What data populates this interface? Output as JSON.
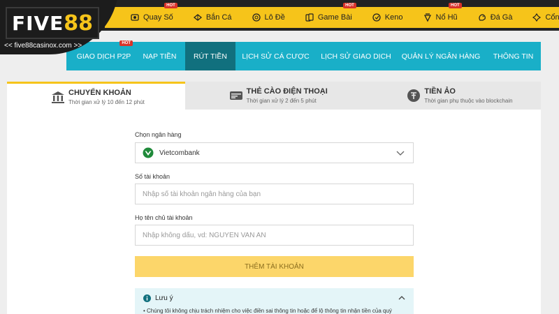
{
  "brand": {
    "logo_text_1": "FIVE",
    "logo_text_2": "88",
    "site_url": "<< five88casinox.com >>"
  },
  "game_nav": [
    {
      "label": "Quay Số",
      "icon": "lottery-icon",
      "hot": "HOT"
    },
    {
      "label": "Bắn Cá",
      "icon": "fish-icon",
      "hot": ""
    },
    {
      "label": "Lô Đề",
      "icon": "ball-icon",
      "hot": ""
    },
    {
      "label": "Game Bài",
      "icon": "cards-icon",
      "hot": "HOT"
    },
    {
      "label": "Keno",
      "icon": "keno-icon",
      "hot": ""
    },
    {
      "label": "Nổ Hũ",
      "icon": "slot-icon",
      "hot": "HOT"
    },
    {
      "label": "Đá Gà",
      "icon": "rooster-icon",
      "hot": ""
    },
    {
      "label": "Cổng Game",
      "icon": "gamepad-icon",
      "hot": ""
    }
  ],
  "account_tabs": [
    {
      "label": "GIAO DỊCH P2P",
      "hot": "HOT"
    },
    {
      "label": "NẠP TIỀN",
      "hot": ""
    },
    {
      "label": "RÚT TIỀN",
      "hot": ""
    },
    {
      "label": "LỊCH SỬ CÁ CƯỢC",
      "hot": ""
    },
    {
      "label": "LỊCH SỬ GIAO DỊCH",
      "hot": ""
    },
    {
      "label": "QUẢN LÝ NGÂN HÀNG",
      "hot": ""
    },
    {
      "label": "THÔNG TIN",
      "hot": ""
    }
  ],
  "methods": [
    {
      "title": "CHUYỂN KHOẢN",
      "sub": "Thời gian xử lý 10 đến 12 phút",
      "icon": "bank-icon"
    },
    {
      "title": "THẺ CÀO ĐIỆN THOẠI",
      "sub": "Thời gian xử lý 2 đến 5 phút",
      "icon": "card-icon"
    },
    {
      "title": "TIỀN ẢO",
      "sub": "Thời gian phụ thuộc vào blockchain",
      "icon": "crypto-icon"
    }
  ],
  "form": {
    "bank_label": "Chọn ngân hàng",
    "bank_value": "Vietcombank",
    "account_label": "Số tài khoản",
    "account_placeholder": "Nhập số tài khoản ngân hàng của bạn",
    "holder_label": "Họ tên chủ tài khoản",
    "holder_placeholder": "Nhập không dấu, vd: NGUYEN VAN AN",
    "submit_label": "THÊM TÀI KHOẢN"
  },
  "note": {
    "title": "Lưu ý",
    "text": "•  Chúng tôi không chịu trách nhiệm cho việc điền sai thông tin hoặc để lộ thông tin nhận tiền của quý"
  },
  "colors": {
    "accent_yellow": "#f6c41a",
    "nav_teal": "#19afc8",
    "active_teal": "#11707e",
    "hot_red": "#d9332a"
  }
}
